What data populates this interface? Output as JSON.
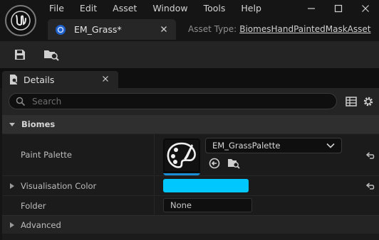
{
  "menu": [
    "File",
    "Edit",
    "Asset",
    "Window",
    "Tools",
    "Help"
  ],
  "tab": {
    "title": "EM_Grass*"
  },
  "asset_type": {
    "label": "Asset Type:",
    "value": "BiomesHandPaintedMaskAsset"
  },
  "details_tab": {
    "label": "Details"
  },
  "search": {
    "placeholder": "Search"
  },
  "category": {
    "label": "Biomes"
  },
  "properties": {
    "paint_palette": {
      "label": "Paint Palette",
      "value": "EM_GrassPalette"
    },
    "visualisation_color": {
      "label": "Visualisation Color",
      "color": "#00c8ff"
    },
    "folder": {
      "label": "Folder",
      "value": "None"
    }
  },
  "advanced": {
    "label": "Advanced"
  },
  "colors": {
    "accent": "#1a8fd6",
    "swatch": "#00c8ff",
    "bg": "#151515",
    "panel": "#242424"
  },
  "icons": [
    "unreal-logo-icon",
    "minimize-icon",
    "maximize-icon",
    "close-icon",
    "asset-icon",
    "save-icon",
    "browse-icon",
    "details-icon",
    "search-icon",
    "table-icon",
    "gear-icon",
    "arrow-down-icon",
    "palette-icon",
    "chevron-down-icon",
    "use-selected-icon",
    "browse-folder-icon",
    "reset-icon",
    "expand-arrow-icon"
  ]
}
